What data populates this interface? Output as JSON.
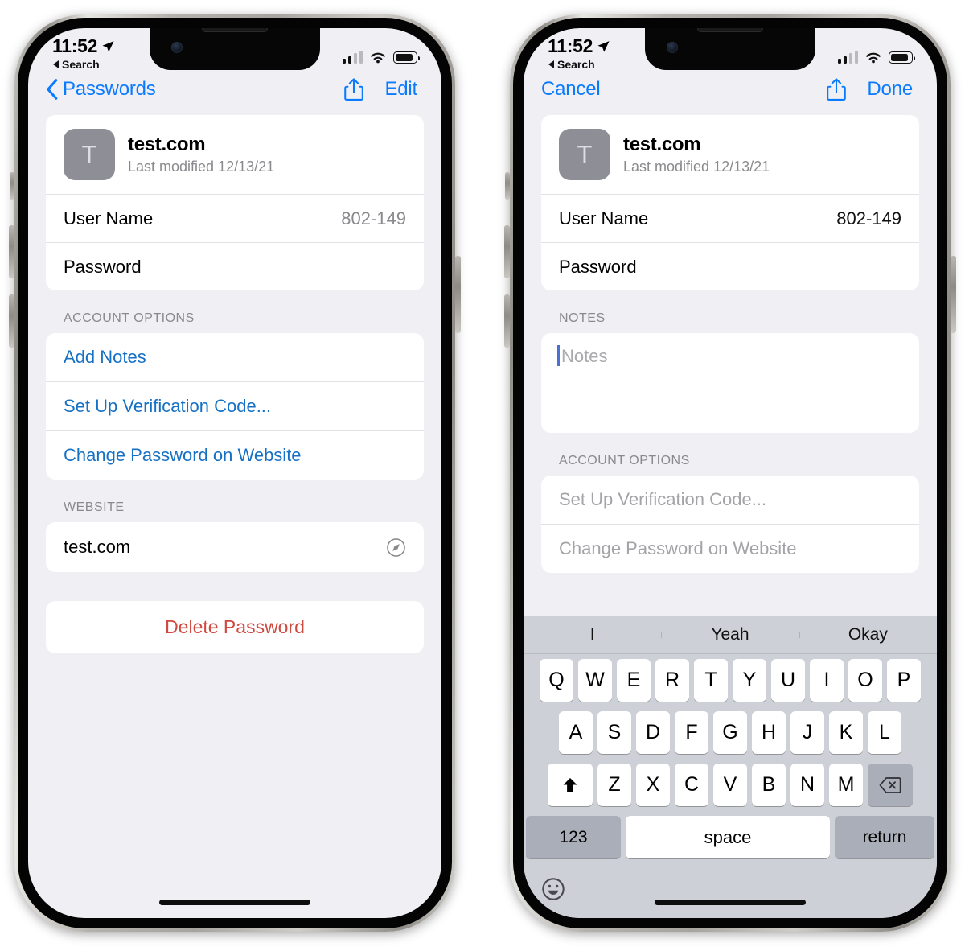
{
  "status_bar": {
    "time": "11:52",
    "back_label": "Search",
    "location_icon": "location-arrow-icon",
    "signal_icon": "cellular-signal-icon",
    "wifi_icon": "wifi-icon",
    "battery_icon": "battery-icon"
  },
  "left_phone": {
    "nav": {
      "back_label": "Passwords",
      "back_icon": "chevron-left-icon",
      "share_icon": "share-icon",
      "edit_label": "Edit"
    },
    "account": {
      "avatar_letter": "T",
      "title": "test.com",
      "subtitle": "Last modified 12/13/21",
      "rows": [
        {
          "label": "User Name",
          "value": "802-149"
        },
        {
          "label": "Password",
          "value": ""
        }
      ]
    },
    "account_options": {
      "header": "ACCOUNT OPTIONS",
      "items": [
        "Add Notes",
        "Set Up Verification Code...",
        "Change Password on Website"
      ]
    },
    "website": {
      "header": "WEBSITE",
      "value": "test.com",
      "open_icon": "safari-compass-icon"
    },
    "delete_label": "Delete Password"
  },
  "right_phone": {
    "nav": {
      "cancel_label": "Cancel",
      "share_icon": "share-icon",
      "done_label": "Done"
    },
    "account": {
      "avatar_letter": "T",
      "title": "test.com",
      "subtitle": "Last modified 12/13/21",
      "rows": [
        {
          "label": "User Name",
          "value": "802-149"
        },
        {
          "label": "Password",
          "value": ""
        }
      ]
    },
    "notes": {
      "header": "NOTES",
      "placeholder": "Notes",
      "value": ""
    },
    "account_options": {
      "header": "ACCOUNT OPTIONS",
      "items": [
        "Set Up Verification Code...",
        "Change Password on Website"
      ]
    },
    "keyboard": {
      "predictions": [
        "I",
        "Yeah",
        "Okay"
      ],
      "row1": [
        "Q",
        "W",
        "E",
        "R",
        "T",
        "Y",
        "U",
        "I",
        "O",
        "P"
      ],
      "row2": [
        "A",
        "S",
        "D",
        "F",
        "G",
        "H",
        "J",
        "K",
        "L"
      ],
      "row3": [
        "Z",
        "X",
        "C",
        "V",
        "B",
        "N",
        "M"
      ],
      "shift_icon": "shift-up-arrow-icon",
      "delete_icon": "backspace-delete-icon",
      "numbers_label": "123",
      "space_label": "space",
      "return_label": "return",
      "emoji_icon": "emoji-smiley-icon"
    }
  },
  "colors": {
    "accent_blue": "#0a7aff",
    "link_blue": "#1671c4",
    "destructive_red": "#d0493f",
    "screen_bg": "#f0eff4",
    "keyboard_bg": "#cdd0d6"
  }
}
